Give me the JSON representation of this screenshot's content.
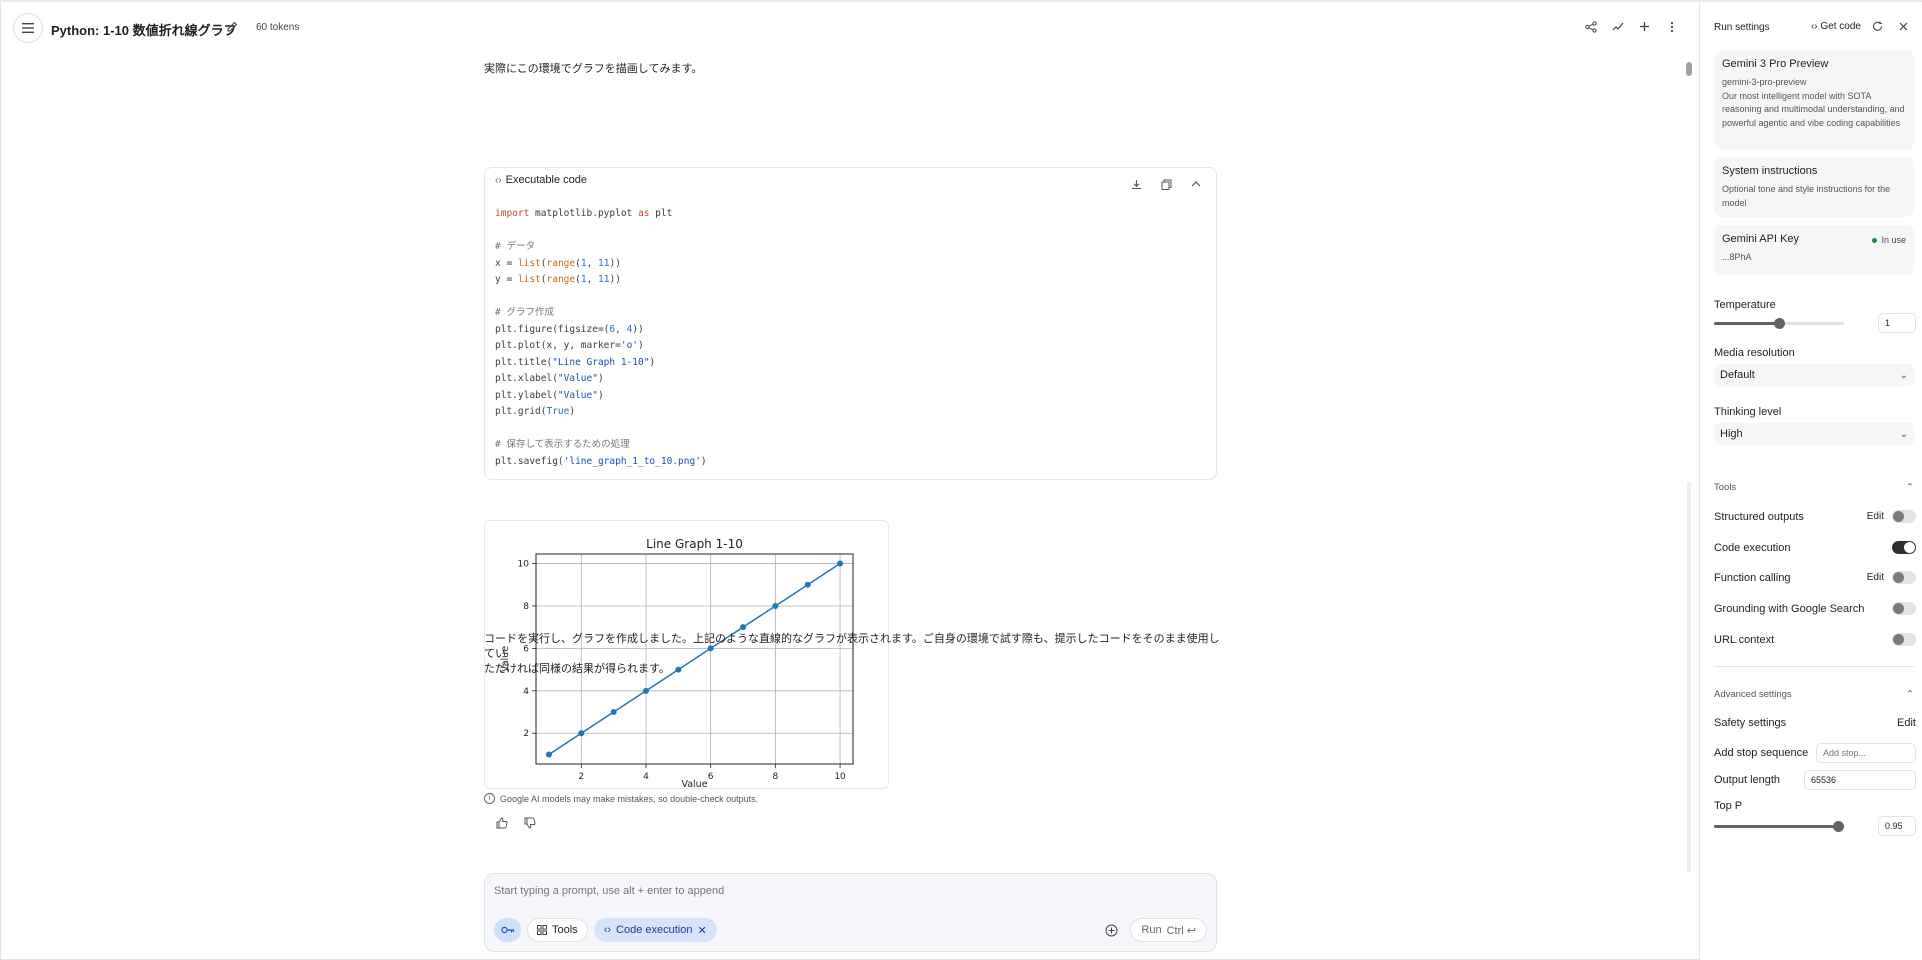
{
  "header": {
    "title": "Python: 1-10 数値折れ線グラフ",
    "tokens": "60 tokens"
  },
  "chat": {
    "intro": "実際にこの環境でグラフを描画してみます。",
    "code_header": "Executable code",
    "code_lines": [
      "import matplotlib.pyplot as plt",
      "",
      "# データ",
      "x = list(range(1, 11))",
      "y = list(range(1, 11))",
      "",
      "# グラフ作成",
      "plt.figure(figsize=(6, 4))",
      "plt.plot(x, y, marker='o')",
      "plt.title(\"Line Graph 1-10\")",
      "plt.xlabel(\"Value\")",
      "plt.ylabel(\"Value\")",
      "plt.grid(True)",
      "",
      "# 保存して表示するための処理",
      "plt.savefig('line_graph_1_to_10.png')"
    ],
    "result_line1": "コードを実行し、グラフを作成しました。上記のような直線的なグラフが表示されます。ご自身の環境で試す際も、提示したコードをそのまま使用してい",
    "result_line2": "ただければ同様の結果が得られます。",
    "disclaimer": "Google AI models may make mistakes, so double-check outputs."
  },
  "chart_data": {
    "type": "line",
    "title": "Line Graph 1-10",
    "xlabel": "Value",
    "ylabel": "Value",
    "x": [
      1,
      2,
      3,
      4,
      5,
      6,
      7,
      8,
      9,
      10
    ],
    "series": [
      {
        "values": [
          1,
          2,
          3,
          4,
          5,
          6,
          7,
          8,
          9,
          10
        ],
        "color": "#1f77b4"
      }
    ],
    "xticks": [
      "2",
      "4",
      "6",
      "8",
      "10"
    ],
    "yticks": [
      "2",
      "4",
      "6",
      "8",
      "10"
    ],
    "xlim": [
      0.6,
      10.4
    ],
    "ylim": [
      0.55,
      10.45
    ],
    "grid": true
  },
  "prompt": {
    "placeholder": "Start typing a prompt, use alt + enter to append",
    "tools_label": "Tools",
    "code_exec_label": "Code execution",
    "run_label": "Run",
    "run_shortcut": "Ctrl ↩"
  },
  "panel": {
    "title": "Run settings",
    "get_code": "Get code",
    "model_name": "Gemini 3 Pro Preview",
    "model_id": "gemini-3-pro-preview",
    "model_desc": "Our most intelligent model with SOTA reasoning and multimodal understanding, and powerful agentic and vibe coding capabilities",
    "system_title": "System instructions",
    "system_desc": "Optional tone and style instructions for the model",
    "api_title": "Gemini API Key",
    "api_status": "In use",
    "api_key": "...8PhA",
    "temperature_label": "Temperature",
    "temperature_value": "1",
    "temperature_fraction": 0.5,
    "media_label": "Media resolution",
    "media_value": "Default",
    "thinking_label": "Thinking level",
    "thinking_value": "High",
    "tools_header": "Tools",
    "structured_label": "Structured outputs",
    "code_execution_label": "Code execution",
    "function_label": "Function calling",
    "grounding_label": "Grounding with Google Search",
    "url_label": "URL context",
    "edit_label": "Edit",
    "advanced_header": "Advanced settings",
    "safety_label": "Safety settings",
    "stop_label": "Add stop sequence",
    "stop_placeholder": "Add stop...",
    "output_label": "Output length",
    "output_value": "65536",
    "topp_label": "Top P",
    "topp_value": "0.95",
    "topp_fraction": 0.95
  },
  "colors": {
    "accent": "#1a56c4",
    "chart_line": "#1f77b4",
    "toggle_on": "#2c2f33"
  }
}
